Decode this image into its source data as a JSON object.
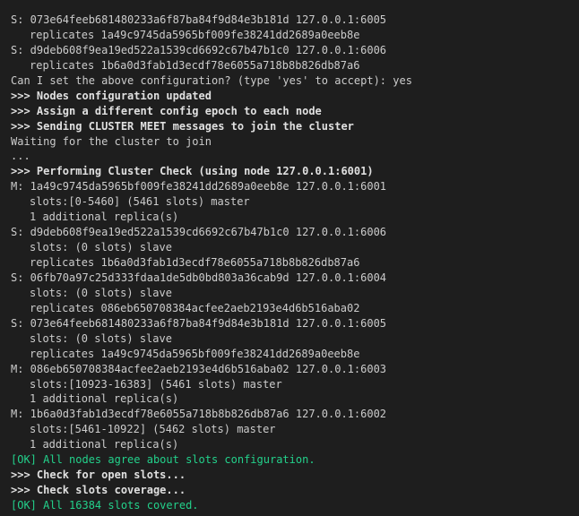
{
  "colors": {
    "background": "#1e1e1e",
    "text": "#cccccc",
    "header_text": "#e0e0e0",
    "ok_text": "#23d18b"
  },
  "terminal": {
    "lines": [
      {
        "style": "normal",
        "text": "S: 073e64feeb681480233a6f87ba84f9d84e3b181d 127.0.0.1:6005"
      },
      {
        "style": "indent",
        "text": "replicates 1a49c9745da5965bf009fe38241dd2689a0eeb8e"
      },
      {
        "style": "normal",
        "text": "S: d9deb608f9ea19ed522a1539cd6692c67b47b1c0 127.0.0.1:6006"
      },
      {
        "style": "indent",
        "text": "replicates 1b6a0d3fab1d3ecdf78e6055a718b8b826db87a6"
      },
      {
        "style": "normal",
        "text": "Can I set the above configuration? (type 'yes' to accept): yes"
      },
      {
        "style": "header",
        "text": ">>> Nodes configuration updated"
      },
      {
        "style": "header",
        "text": ">>> Assign a different config epoch to each node"
      },
      {
        "style": "header",
        "text": ">>> Sending CLUSTER MEET messages to join the cluster"
      },
      {
        "style": "normal",
        "text": "Waiting for the cluster to join"
      },
      {
        "style": "normal",
        "text": "..."
      },
      {
        "style": "header",
        "text": ">>> Performing Cluster Check (using node 127.0.0.1:6001)"
      },
      {
        "style": "normal",
        "text": "M: 1a49c9745da5965bf009fe38241dd2689a0eeb8e 127.0.0.1:6001"
      },
      {
        "style": "indent",
        "text": "slots:[0-5460] (5461 slots) master"
      },
      {
        "style": "indent",
        "text": "1 additional replica(s)"
      },
      {
        "style": "normal",
        "text": "S: d9deb608f9ea19ed522a1539cd6692c67b47b1c0 127.0.0.1:6006"
      },
      {
        "style": "indent",
        "text": "slots: (0 slots) slave"
      },
      {
        "style": "indent",
        "text": "replicates 1b6a0d3fab1d3ecdf78e6055a718b8b826db87a6"
      },
      {
        "style": "normal",
        "text": "S: 06fb70a97c25d333fdaa1de5db0bd803a36cab9d 127.0.0.1:6004"
      },
      {
        "style": "indent",
        "text": "slots: (0 slots) slave"
      },
      {
        "style": "indent",
        "text": "replicates 086eb650708384acfee2aeb2193e4d6b516aba02"
      },
      {
        "style": "normal",
        "text": "S: 073e64feeb681480233a6f87ba84f9d84e3b181d 127.0.0.1:6005"
      },
      {
        "style": "indent",
        "text": "slots: (0 slots) slave"
      },
      {
        "style": "indent",
        "text": "replicates 1a49c9745da5965bf009fe38241dd2689a0eeb8e"
      },
      {
        "style": "normal",
        "text": "M: 086eb650708384acfee2aeb2193e4d6b516aba02 127.0.0.1:6003"
      },
      {
        "style": "indent",
        "text": "slots:[10923-16383] (5461 slots) master"
      },
      {
        "style": "indent",
        "text": "1 additional replica(s)"
      },
      {
        "style": "normal",
        "text": "M: 1b6a0d3fab1d3ecdf78e6055a718b8b826db87a6 127.0.0.1:6002"
      },
      {
        "style": "indent",
        "text": "slots:[5461-10922] (5462 slots) master"
      },
      {
        "style": "indent",
        "text": "1 additional replica(s)"
      },
      {
        "style": "ok",
        "text": "[OK] All nodes agree about slots configuration."
      },
      {
        "style": "header",
        "text": ">>> Check for open slots..."
      },
      {
        "style": "header",
        "text": ">>> Check slots coverage..."
      },
      {
        "style": "ok",
        "text": "[OK] All 16384 slots covered."
      }
    ]
  }
}
